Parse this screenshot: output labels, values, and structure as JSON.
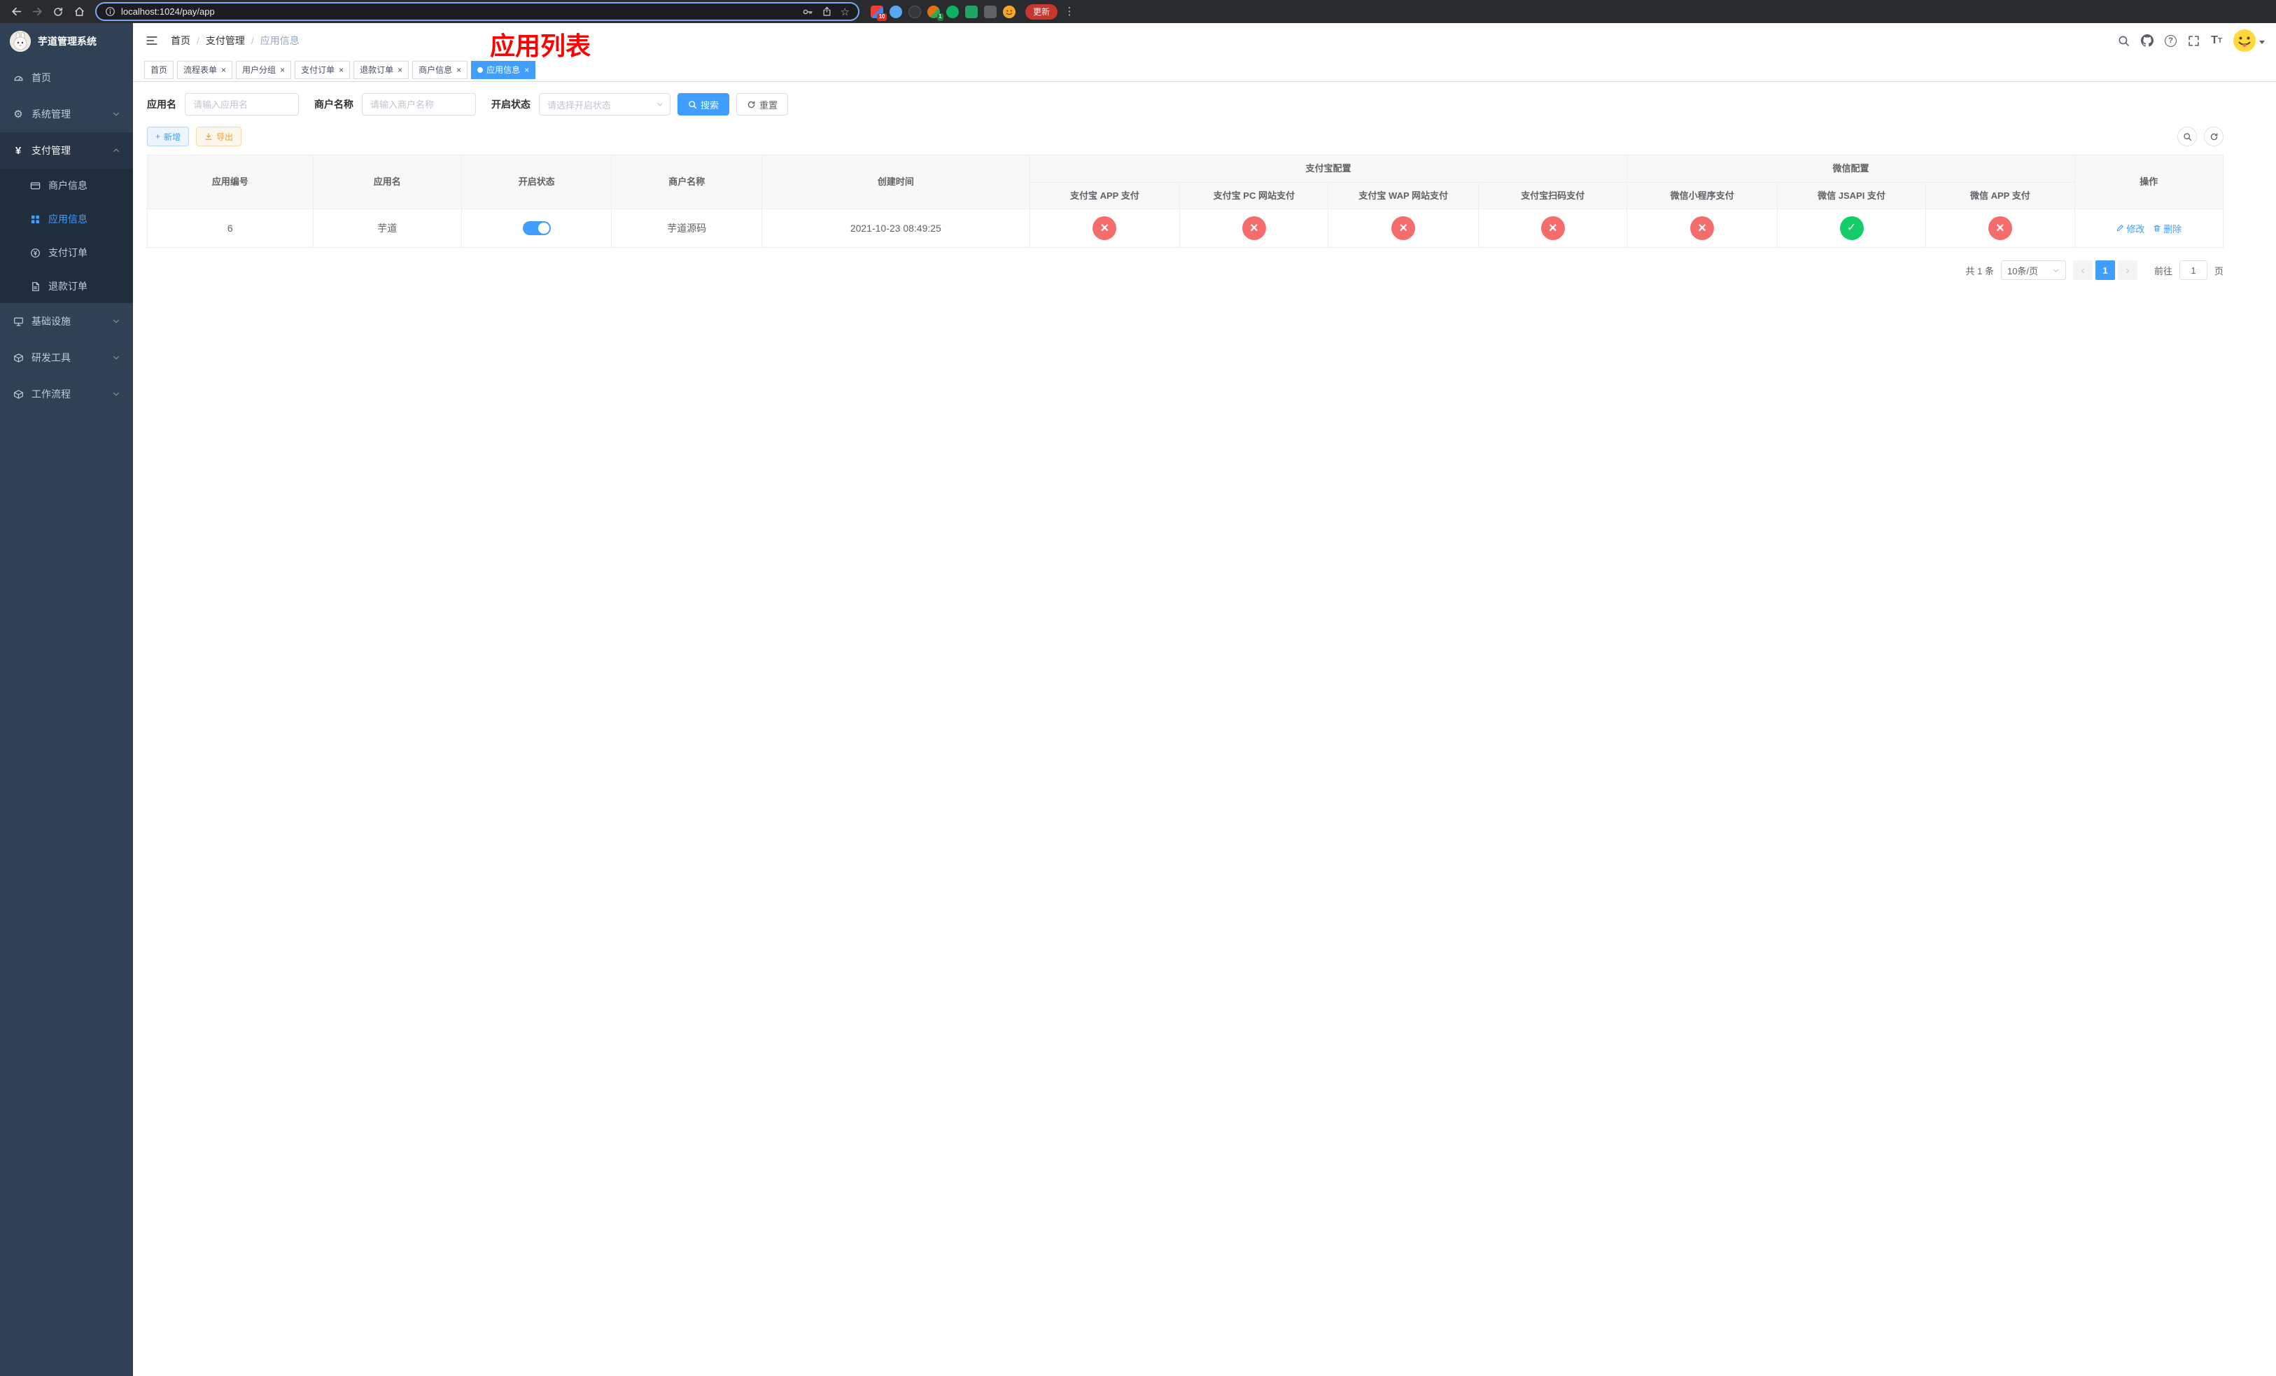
{
  "colors": {
    "accent": "#409eff",
    "success": "#13ce66",
    "danger": "#f56c6c",
    "warning": "#e6a23c",
    "annotation_red": "#ff0000",
    "sidebar_bg": "#304156"
  },
  "browser": {
    "url": "localhost:1024/pay/app",
    "update_label": "更新",
    "ext_badge_1": "10",
    "ext_badge_2": "1"
  },
  "sidebar": {
    "title": "芋道管理系统",
    "items": [
      {
        "label": "首页"
      },
      {
        "label": "系统管理"
      },
      {
        "label": "支付管理",
        "children": [
          {
            "label": "商户信息"
          },
          {
            "label": "应用信息"
          },
          {
            "label": "支付订单"
          },
          {
            "label": "退款订单"
          }
        ]
      },
      {
        "label": "基础设施"
      },
      {
        "label": "研发工具"
      },
      {
        "label": "工作流程"
      }
    ]
  },
  "header": {
    "breadcrumb": [
      "首页",
      "支付管理",
      "应用信息"
    ],
    "page_annotation": "应用列表"
  },
  "tabs": [
    {
      "label": "首页"
    },
    {
      "label": "流程表单"
    },
    {
      "label": "用户分组"
    },
    {
      "label": "支付订单"
    },
    {
      "label": "退款订单"
    },
    {
      "label": "商户信息"
    },
    {
      "label": "应用信息"
    }
  ],
  "filters": {
    "app_name_label": "应用名",
    "app_name_placeholder": "请输入应用名",
    "merchant_label": "商户名称",
    "merchant_placeholder": "请输入商户名称",
    "status_label": "开启状态",
    "status_placeholder": "请选择开启状态",
    "search_label": "搜索",
    "reset_label": "重置"
  },
  "toolbar": {
    "add_label": "新增",
    "export_label": "导出"
  },
  "table": {
    "group_alipay": "支付宝配置",
    "group_wechat": "微信配置",
    "columns": [
      "应用编号",
      "应用名",
      "开启状态",
      "商户名称",
      "创建时间",
      "支付宝 APP 支付",
      "支付宝 PC 网站支付",
      "支付宝 WAP 网站支付",
      "支付宝扫码支付",
      "微信小程序支付",
      "微信 JSAPI 支付",
      "微信 APP 支付",
      "操作"
    ],
    "edit_label": "修改",
    "delete_label": "删除",
    "rows": [
      {
        "id": "6",
        "name": "芋道",
        "enabled": true,
        "merchant": "芋道源码",
        "created": "2021-10-23 08:49:25",
        "alipay_app": false,
        "alipay_pc": false,
        "alipay_wap": false,
        "alipay_qr": false,
        "wx_mini": false,
        "wx_jsapi": true,
        "wx_app": false
      }
    ]
  },
  "pagination": {
    "total_label": "共 1 条",
    "page_size": "10条/页",
    "current_page": "1",
    "goto_label": "前往",
    "goto_value": "1",
    "page_suffix": "页"
  }
}
